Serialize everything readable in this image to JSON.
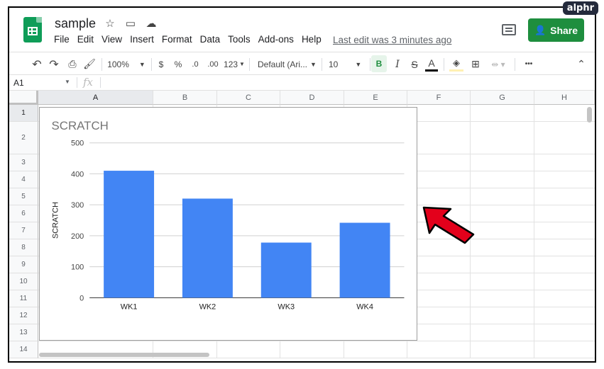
{
  "badge": "alphr",
  "doc": {
    "title": "sample",
    "last_edit": "Last edit was 3 minutes ago"
  },
  "menu": [
    "File",
    "Edit",
    "View",
    "Insert",
    "Format",
    "Data",
    "Tools",
    "Add-ons",
    "Help"
  ],
  "share_label": "Share",
  "toolbar": {
    "zoom": "100%",
    "currency": "$",
    "percent": "%",
    "dec_decrease": ".0",
    "dec_increase": ".00",
    "more_formats": "123",
    "font": "Default (Ari...",
    "font_size": "10",
    "bold": "B",
    "italic": "I",
    "strike": "S",
    "text_color": "A",
    "more": "•••"
  },
  "formula_bar": {
    "cell_ref": "A1",
    "fx": "fx"
  },
  "columns": [
    "A",
    "B",
    "C",
    "D",
    "E",
    "F",
    "G",
    "H"
  ],
  "rows": [
    "1",
    "2",
    "3",
    "4",
    "5",
    "6",
    "7",
    "8",
    "9",
    "10",
    "11",
    "12",
    "13",
    "14"
  ],
  "colors": {
    "bar": "#4285f4",
    "share": "#1e8e3e",
    "arrow": "#e3001b"
  },
  "chart_data": {
    "type": "bar",
    "title": "SCRATCH",
    "ylabel": "SCRATCH",
    "xlabel": "",
    "categories": [
      "WK1",
      "WK2",
      "WK3",
      "WK4"
    ],
    "values": [
      410,
      320,
      178,
      242
    ],
    "ylim": [
      0,
      500
    ],
    "yticks": [
      0,
      100,
      200,
      300,
      400,
      500
    ],
    "grid": true
  }
}
